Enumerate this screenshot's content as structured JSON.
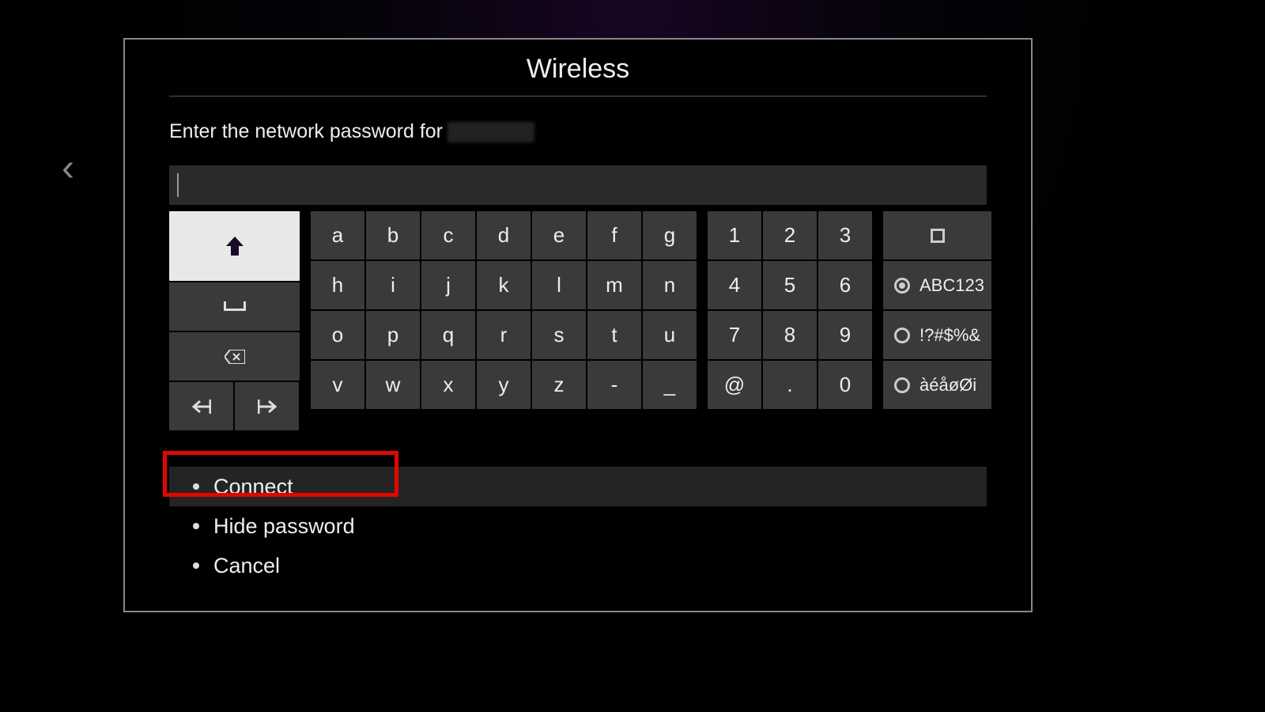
{
  "dialog": {
    "title": "Wireless",
    "prompt_prefix": "Enter the network password for ",
    "ssid_redacted": true,
    "password_value": ""
  },
  "keyboard": {
    "control": {
      "shift_selected": true,
      "space": "␣",
      "backspace": "⌫",
      "cursor_left": "⇤",
      "cursor_right": "⇥"
    },
    "alpha_rows": [
      [
        "a",
        "b",
        "c",
        "d",
        "e",
        "f",
        "g"
      ],
      [
        "h",
        "i",
        "j",
        "k",
        "l",
        "m",
        "n"
      ],
      [
        "o",
        "p",
        "q",
        "r",
        "s",
        "t",
        "u"
      ],
      [
        "v",
        "w",
        "x",
        "y",
        "z",
        "-",
        "_"
      ]
    ],
    "num_rows": [
      [
        "1",
        "2",
        "3"
      ],
      [
        "4",
        "5",
        "6"
      ],
      [
        "7",
        "8",
        "9"
      ],
      [
        "@",
        ".",
        "0"
      ]
    ],
    "modes": {
      "shift_icon": "square-shift",
      "alnum": "ABC123",
      "symbols": "!?#$%&",
      "intl": "àéåøØi",
      "selected": "alnum"
    }
  },
  "actions": {
    "connect": "Connect",
    "hide": "Hide password",
    "cancel": "Cancel",
    "focused": "connect"
  }
}
